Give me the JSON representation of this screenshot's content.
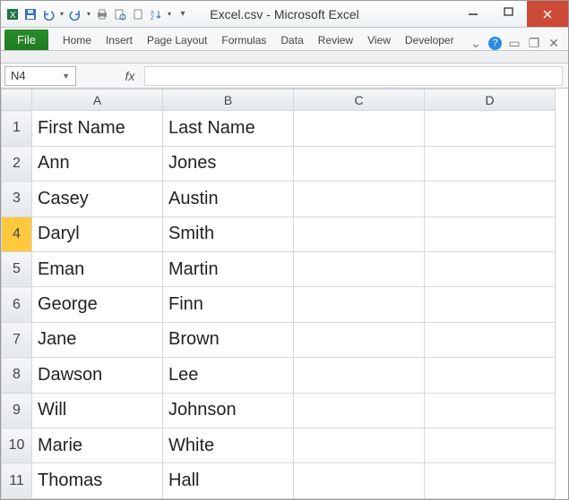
{
  "title": "Excel.csv - Microsoft Excel",
  "qat": {
    "excel_icon": "excel",
    "save_icon": "save",
    "undo_icon": "undo",
    "redo_icon": "redo",
    "print_icon": "print",
    "preview_icon": "preview",
    "new_icon": "new",
    "sort_icon": "sort",
    "custom_icon": "customize"
  },
  "tabs": {
    "file": "File",
    "home": "Home",
    "insert": "Insert",
    "page_layout": "Page Layout",
    "formulas": "Formulas",
    "data": "Data",
    "review": "Review",
    "view": "View",
    "developer": "Developer"
  },
  "namebox": "N4",
  "fx_label": "fx",
  "columns": [
    "A",
    "B",
    "C",
    "D"
  ],
  "active_row": 4,
  "cells": {
    "A1": "First Name",
    "B1": "Last Name",
    "A2": "Ann",
    "B2": "Jones",
    "A3": "Casey",
    "B3": "Austin",
    "A4": "Daryl",
    "B4": "Smith",
    "A5": "Eman",
    "B5": "Martin",
    "A6": "George",
    "B6": "Finn",
    "A7": "Jane",
    "B7": "Brown",
    "A8": "Dawson",
    "B8": "Lee",
    "A9": "Will",
    "B9": "Johnson",
    "A10": "Marie",
    "B10": "White",
    "A11": "Thomas",
    "B11": "Hall"
  },
  "row_count": 11
}
